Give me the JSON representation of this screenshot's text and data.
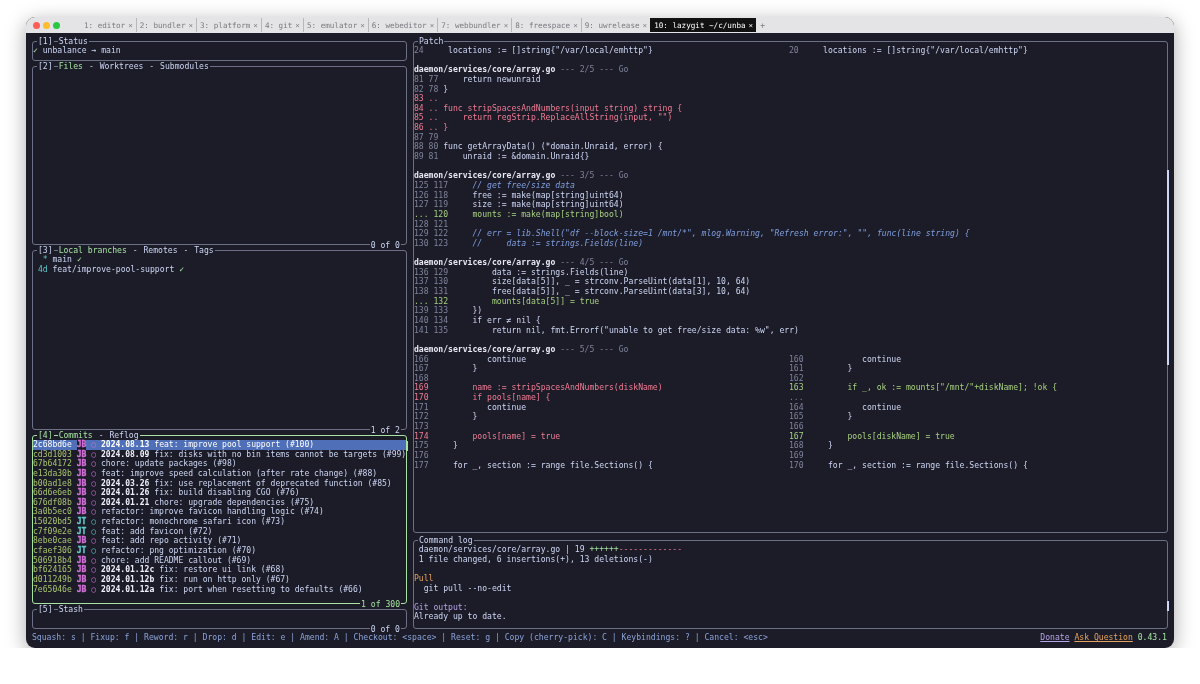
{
  "tabs": [
    {
      "label": "1: editor",
      "close": "×",
      "selected": false
    },
    {
      "label": "2: bundler",
      "close": "×",
      "selected": false
    },
    {
      "label": "3: platform",
      "close": "×",
      "selected": false
    },
    {
      "label": "4: git",
      "close": "×",
      "selected": false
    },
    {
      "label": "5: emulator",
      "close": "×",
      "selected": false
    },
    {
      "label": "6: webeditor",
      "close": "×",
      "selected": false
    },
    {
      "label": "7: webbundler",
      "close": "×",
      "selected": false
    },
    {
      "label": "8: freespace",
      "close": "×",
      "selected": false
    },
    {
      "label": "9: uwrelease",
      "close": "×",
      "selected": false
    },
    {
      "label": "10: lazygit ~/c/unba",
      "close": "×",
      "selected": true
    }
  ],
  "new_tab": "+",
  "status_panel": {
    "number": "[1]",
    "tabs": [
      {
        "label": "Status",
        "selected": false
      }
    ],
    "check": "✓",
    "repo": "unbalance",
    "arrow": "→",
    "branch": "main"
  },
  "files_panel": {
    "number": "[2]",
    "separator": "-",
    "tabs": [
      {
        "label": "Files",
        "selected": true
      },
      {
        "label": "Worktrees",
        "selected": false
      },
      {
        "label": "Submodules",
        "selected": false
      }
    ],
    "footer": "0 of 0"
  },
  "branches_panel": {
    "number": "[3]",
    "separator": "-",
    "tabs": [
      {
        "label": "Local branches",
        "selected": true
      },
      {
        "label": "Remotes",
        "selected": false
      },
      {
        "label": "Tags",
        "selected": false
      }
    ],
    "footer": "1 of 2",
    "branches": [
      {
        "recency": "*",
        "name": "main",
        "mark": "✓"
      },
      {
        "recency": "4d",
        "name": "feat/improve-pool-support",
        "mark": "✓"
      }
    ]
  },
  "commits_panel": {
    "number": "[4]",
    "separator": "-",
    "active": true,
    "tabs": [
      {
        "label": "Commits",
        "selected": true
      },
      {
        "label": "Reflog",
        "selected": false
      }
    ],
    "footer": "1 of 300",
    "commits": [
      {
        "hash": "2c68bd6e",
        "author": "JB",
        "color": "#d16fd6",
        "graph": "○",
        "tag": "2024.08.13",
        "message": "feat: improve pool support (#100)",
        "selected": true
      },
      {
        "hash": "cd3d1003",
        "author": "JB",
        "color": "#d16fd6",
        "graph": "○",
        "tag": "2024.08.09",
        "message": "fix: disks with no bin items cannot be targets (#99)",
        "selected": false
      },
      {
        "hash": "67b64172",
        "author": "JB",
        "color": "#d16fd6",
        "graph": "○",
        "message": "chore: update packages (#98)",
        "selected": false
      },
      {
        "hash": "e13da30b",
        "author": "JB",
        "color": "#d16fd6",
        "graph": "○",
        "message": "feat: improve speed calculation (after rate change) (#88)",
        "selected": false
      },
      {
        "hash": "b00ad1e8",
        "author": "JB",
        "color": "#d16fd6",
        "graph": "○",
        "tag": "2024.03.26",
        "message": "fix: use replacement of deprecated function (#85)",
        "selected": false
      },
      {
        "hash": "66d6e6eb",
        "author": "JB",
        "color": "#d16fd6",
        "graph": "○",
        "tag": "2024.01.26",
        "message": "fix: build disabling CGO (#76)",
        "selected": false
      },
      {
        "hash": "676df08b",
        "author": "JB",
        "color": "#d16fd6",
        "graph": "○",
        "tag": "2024.01.21",
        "message": "chore: upgrade dependencies (#75)",
        "selected": false
      },
      {
        "hash": "3a0b5ec0",
        "author": "JB",
        "color": "#d16fd6",
        "graph": "○",
        "message": "refactor: improve favicon handling logic (#74)",
        "selected": false
      },
      {
        "hash": "15020bd5",
        "author": "JT",
        "color": "#5fc8c8",
        "graph": "○",
        "message": "refactor: monochrome safari icon (#73)",
        "selected": false
      },
      {
        "hash": "c7f09e2e",
        "author": "JT",
        "color": "#5fc8c8",
        "graph": "○",
        "message": "feat: add favicon (#72)",
        "selected": false
      },
      {
        "hash": "8ebe0cae",
        "author": "JB",
        "color": "#d16fd6",
        "graph": "○",
        "message": "feat: add repo activity (#71)",
        "selected": false
      },
      {
        "hash": "cfaef306",
        "author": "JT",
        "color": "#5fc8c8",
        "graph": "○",
        "message": "refactor: png optimization (#70)",
        "selected": false
      },
      {
        "hash": "506918b4",
        "author": "JB",
        "color": "#d16fd6",
        "graph": "○",
        "message": "chore: add README callout (#69)",
        "selected": false
      },
      {
        "hash": "bf624165",
        "author": "JB",
        "color": "#d16fd6",
        "graph": "○",
        "tag": "2024.01.12c",
        "message": "fix: restore ui link (#68)",
        "selected": false
      },
      {
        "hash": "d011249b",
        "author": "JB",
        "color": "#d16fd6",
        "graph": "○",
        "tag": "2024.01.12b",
        "message": "fix: run on http only (#67)",
        "selected": false
      },
      {
        "hash": "7e65046e",
        "author": "JB",
        "color": "#d16fd6",
        "graph": "○",
        "tag": "2024.01.12a",
        "message": "fix: port when resetting to defaults (#66)",
        "selected": false
      }
    ]
  },
  "stash_panel": {
    "number": "[5]",
    "tabs": [
      {
        "label": "Stash",
        "selected": false
      }
    ],
    "footer": "0 of 0"
  },
  "patch_panel": {
    "tabs": [
      {
        "label": "Patch",
        "selected": false
      }
    ],
    "rows": [
      {
        "kind": "code",
        "left": {
          "num": "24",
          "code": "    locations := []string{\"/var/local/emhttp\"}",
          "kind": "context"
        },
        "right": {
          "num": "20",
          "code": "    locations := []string{\"/var/local/emhttp\"}",
          "kind": "context"
        }
      },
      {
        "kind": "blank"
      },
      {
        "kind": "header",
        "file": "daemon/services/core/array.go",
        "info": "--- 2/5 --- Go"
      },
      {
        "kind": "code",
        "left": {
          "num": "81 77",
          "code": "    return newunraid",
          "kind": "context"
        }
      },
      {
        "kind": "code",
        "left": {
          "num": "82 78",
          "code": "}",
          "kind": "context"
        }
      },
      {
        "kind": "code",
        "left": {
          "num": "83 ..",
          "kind": "removed"
        }
      },
      {
        "kind": "code",
        "left": {
          "num": "84 ..",
          "code": "func stripSpacesAndNumbers(input string) string {",
          "kind": "removed"
        }
      },
      {
        "kind": "code",
        "left": {
          "num": "85 ..",
          "code": "    return regStrip.ReplaceAllString(input, \"\")",
          "kind": "removed"
        }
      },
      {
        "kind": "code",
        "left": {
          "num": "86 ..",
          "code": "}",
          "kind": "removed"
        }
      },
      {
        "kind": "code",
        "left": {
          "num": "87 79",
          "kind": "context"
        }
      },
      {
        "kind": "code",
        "left": {
          "num": "88 80",
          "code": "func getArrayData() (*domain.Unraid, error) {",
          "kind": "context"
        }
      },
      {
        "kind": "code",
        "left": {
          "num": "89 81",
          "code": "    unraid := &domain.Unraid{}",
          "kind": "context"
        }
      },
      {
        "kind": "blank"
      },
      {
        "kind": "header",
        "file": "daemon/services/core/array.go",
        "info": "--- 3/5 --- Go"
      },
      {
        "kind": "code",
        "left": {
          "num": "125 117",
          "code": "    // get free/size data",
          "kind": "comment"
        }
      },
      {
        "kind": "code",
        "left": {
          "num": "126 118",
          "code": "    free := make(map[string]uint64)",
          "kind": "context"
        }
      },
      {
        "kind": "code",
        "left": {
          "num": "127 119",
          "code": "    size := make(map[string]uint64)",
          "kind": "context"
        }
      },
      {
        "kind": "code",
        "left": {
          "num": "... 120",
          "code": "    mounts := make(map[string]bool)",
          "kind": "added"
        }
      },
      {
        "kind": "code",
        "left": {
          "num": "128 121",
          "kind": "context"
        }
      },
      {
        "kind": "code",
        "left": {
          "num": "129 122",
          "code": "    // err = lib.Shell(\"df --block-size=1 /mnt/*\", mlog.Warning, \"Refresh error:\", \"\", func(line string) {",
          "kind": "comment"
        }
      },
      {
        "kind": "code",
        "left": {
          "num": "130 123",
          "code": "    //     data := strings.Fields(line)",
          "kind": "comment"
        }
      },
      {
        "kind": "blank"
      },
      {
        "kind": "header",
        "file": "daemon/services/core/array.go",
        "info": "--- 4/5 --- Go"
      },
      {
        "kind": "code",
        "left": {
          "num": "136 129",
          "code": "        data := strings.Fields(line)",
          "kind": "context"
        }
      },
      {
        "kind": "code",
        "left": {
          "num": "137 130",
          "code": "        size[data[5]], _ = strconv.ParseUint(data[1], 10, 64)",
          "kind": "context"
        }
      },
      {
        "kind": "code",
        "left": {
          "num": "138 131",
          "code": "        free[data[5]], _ = strconv.ParseUint(data[3], 10, 64)",
          "kind": "context"
        }
      },
      {
        "kind": "code",
        "left": {
          "num": "... 132",
          "code": "        mounts[data[5]] = true",
          "kind": "added"
        }
      },
      {
        "kind": "code",
        "left": {
          "num": "139 133",
          "code": "    })",
          "kind": "context"
        }
      },
      {
        "kind": "code",
        "left": {
          "num": "140 134",
          "code": "    if err ≠ nil {",
          "kind": "context"
        }
      },
      {
        "kind": "code",
        "left": {
          "num": "141 135",
          "code": "        return nil, fmt.Errorf(\"unable to get free/size data: %w\", err)",
          "kind": "context"
        }
      },
      {
        "kind": "blank"
      },
      {
        "kind": "header",
        "file": "daemon/services/core/array.go",
        "info": "--- 5/5 --- Go"
      },
      {
        "kind": "code",
        "left": {
          "num": "166",
          "code": "           continue",
          "kind": "context"
        },
        "right": {
          "num": "160",
          "code": "           continue",
          "kind": "context"
        }
      },
      {
        "kind": "code",
        "left": {
          "num": "167",
          "code": "        }",
          "kind": "context"
        },
        "right": {
          "num": "161",
          "code": "        }",
          "kind": "context"
        }
      },
      {
        "kind": "code",
        "left": {
          "num": "168",
          "kind": "context"
        },
        "right": {
          "num": "162",
          "kind": "context"
        }
      },
      {
        "kind": "code",
        "left": {
          "num": "169",
          "code": "        name := stripSpacesAndNumbers(diskName)",
          "kind": "removed"
        },
        "right": {
          "num": "163",
          "code": "        if _, ok := mounts[\"/mnt/\"+diskName]; !ok {",
          "kind": "added"
        }
      },
      {
        "kind": "code",
        "left": {
          "num": "170",
          "code": "        if pools[name] {",
          "kind": "removed"
        },
        "right": {
          "num": "...",
          "kind": "context"
        }
      },
      {
        "kind": "code",
        "left": {
          "num": "171",
          "code": "           continue",
          "kind": "context"
        },
        "right": {
          "num": "164",
          "code": "           continue",
          "kind": "context"
        }
      },
      {
        "kind": "code",
        "left": {
          "num": "172",
          "code": "        }",
          "kind": "context"
        },
        "right": {
          "num": "165",
          "code": "        }",
          "kind": "context"
        }
      },
      {
        "kind": "code",
        "left": {
          "num": "173",
          "kind": "context"
        },
        "right": {
          "num": "166",
          "kind": "context"
        }
      },
      {
        "kind": "code",
        "left": {
          "num": "174",
          "code": "        pools[name] = true",
          "kind": "removed"
        },
        "right": {
          "num": "167",
          "code": "        pools[diskName] = true",
          "kind": "added"
        }
      },
      {
        "kind": "code",
        "left": {
          "num": "175",
          "code": "    }",
          "kind": "context"
        },
        "right": {
          "num": "168",
          "code": "    }",
          "kind": "context"
        }
      },
      {
        "kind": "code",
        "left": {
          "num": "176",
          "kind": "context"
        },
        "right": {
          "num": "169",
          "kind": "context"
        }
      },
      {
        "kind": "code",
        "left": {
          "num": "177",
          "code": "    for _, section := range file.Sections() {",
          "kind": "context"
        },
        "right": {
          "num": "170",
          "code": "    for _, section := range file.Sections() {",
          "kind": "context"
        }
      }
    ]
  },
  "command_log": {
    "tabs": [
      {
        "label": "Command log",
        "selected": false
      }
    ],
    "lines": [
      {
        "kind": "stat",
        "text": " daemon/services/core/array.go | 19 ",
        "plus": "++++++",
        "minus": "-------------"
      },
      {
        "kind": "plain",
        "text": " 1 file changed, 6 insertions(+), 13 deletions(-)"
      },
      {
        "kind": "blank"
      },
      {
        "kind": "heading",
        "text": "Pull"
      },
      {
        "kind": "plain",
        "text": "  git pull --no-edit"
      },
      {
        "kind": "blank"
      },
      {
        "kind": "label",
        "text": "Git output:"
      },
      {
        "kind": "plain",
        "text": "Already up to date."
      }
    ]
  },
  "status_bar": {
    "keybindings": "Squash: s | Fixup: f | Reword: r | Drop: d | Edit: e | Amend: A | Checkout: <space> | Reset: g | Copy (cherry-pick): C | Keybindings: ? | Cancel: <esc>",
    "links": [
      {
        "label": "Donate",
        "kind": "donate"
      },
      {
        "label": "Ask Question",
        "kind": "ask"
      }
    ],
    "version": "0.43.1"
  }
}
